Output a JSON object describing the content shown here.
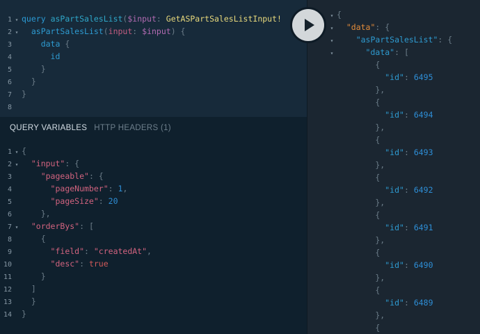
{
  "query_editor": {
    "lines": [
      {
        "n": "1",
        "fold": "▾"
      },
      {
        "n": "2",
        "fold": "▾"
      },
      {
        "n": "3",
        "fold": ""
      },
      {
        "n": "4",
        "fold": ""
      },
      {
        "n": "5",
        "fold": ""
      },
      {
        "n": "6",
        "fold": ""
      },
      {
        "n": "7",
        "fold": ""
      },
      {
        "n": "8",
        "fold": ""
      }
    ],
    "text": {
      "l1_kw": "query",
      "l1_name": "asPartSalesList",
      "l1_open": "(",
      "l1_var": "$input",
      "l1_colon": ": ",
      "l1_type": "GetASPartSalesListInput!",
      "l2_field": "asPartSalesList",
      "l2_open": "(",
      "l2_arg": "input",
      "l2_colon": ": ",
      "l2_var": "$input",
      "l2_close": ") {",
      "l3_field": "data",
      "l3_brace": " {",
      "l4_field": "id",
      "l5_brace": "}",
      "l6_brace": "}",
      "l7_brace": "}"
    }
  },
  "variables_panel": {
    "tab_variables": "QUERY VARIABLES",
    "tab_headers": "HTTP HEADERS (1)",
    "line_numbers": [
      "1",
      "2",
      "3",
      "4",
      "5",
      "6",
      "7",
      "8",
      "9",
      "10",
      "11",
      "12",
      "13",
      "14"
    ],
    "text": {
      "input_key": "\"input\"",
      "pageable_key": "\"pageable\"",
      "pageNumber_key": "\"pageNumber\"",
      "pageNumber_val": "1",
      "pageSize_key": "\"pageSize\"",
      "pageSize_val": "20",
      "orderBys_key": "\"orderBys\"",
      "field_key": "\"field\"",
      "field_val": "\"createdAt\"",
      "desc_key": "\"desc\"",
      "desc_val": "true"
    }
  },
  "run_button": {
    "icon": "play-icon"
  },
  "results": {
    "data_key": "\"data\"",
    "list_key": "\"asPartSalesList\"",
    "inner_data_key": "\"data\"",
    "id_key": "\"id\"",
    "ids": [
      "6495",
      "6494",
      "6493",
      "6492",
      "6491",
      "6490",
      "6489"
    ]
  }
}
